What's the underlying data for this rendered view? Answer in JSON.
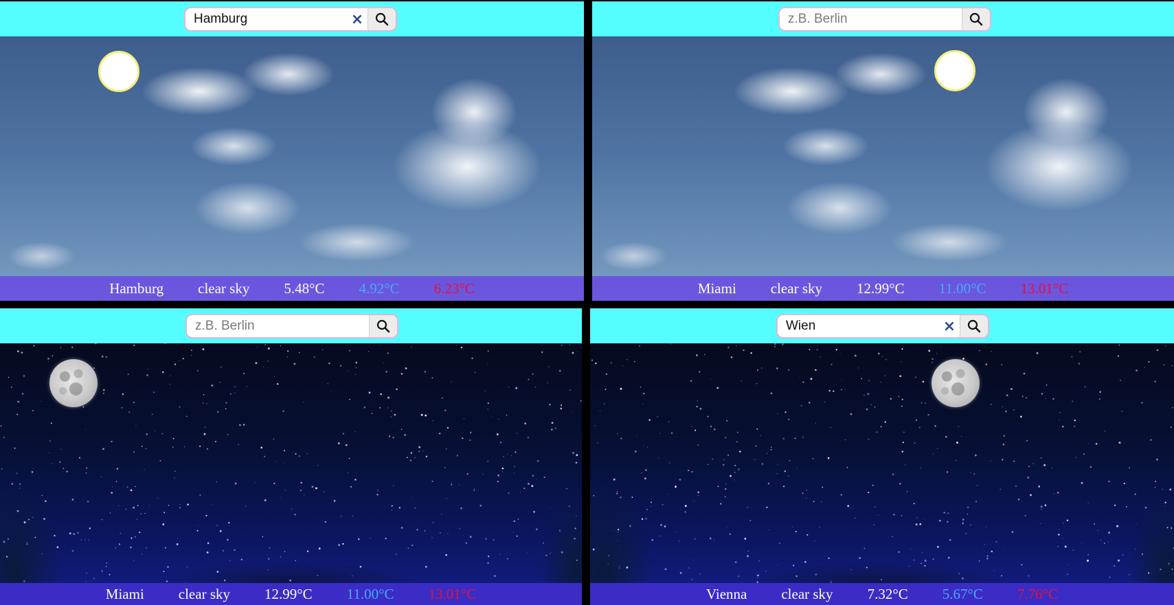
{
  "colors": {
    "topbar": "#55fefe",
    "search_border": "#e2b5d4",
    "infobar_day": "#6950e1",
    "infobar_night": "#3a2cc4",
    "temp_min": "#47a8ff",
    "temp_max": "#e8103a"
  },
  "panels": [
    {
      "search": {
        "value": "Hamburg",
        "placeholder": "z.B. Berlin",
        "clear_icon": "×"
      },
      "weather": {
        "city": "Hamburg",
        "description": "clear sky",
        "temp": "5.48°C",
        "temp_min": "4.92°C",
        "temp_max": "6.23°C"
      },
      "theme": "day",
      "celestial": "sun-icon"
    },
    {
      "search": {
        "value": "",
        "placeholder": "z.B. Berlin"
      },
      "weather": {
        "city": "Miami",
        "description": "clear sky",
        "temp": "12.99°C",
        "temp_min": "11.00°C",
        "temp_max": "13.01°C"
      },
      "theme": "day",
      "celestial": "sun-icon"
    },
    {
      "search": {
        "value": "",
        "placeholder": "z.B. Berlin"
      },
      "weather": {
        "city": "Miami",
        "description": "clear sky",
        "temp": "12.99°C",
        "temp_min": "11.00°C",
        "temp_max": "13.01°C"
      },
      "theme": "night",
      "celestial": "moon-icon"
    },
    {
      "search": {
        "value": "Wien",
        "placeholder": "z.B. Berlin",
        "clear_icon": "×"
      },
      "weather": {
        "city": "Vienna",
        "description": "clear sky",
        "temp": "7.32°C",
        "temp_min": "5.67°C",
        "temp_max": "7.76°C"
      },
      "theme": "night",
      "celestial": "moon-icon"
    }
  ]
}
